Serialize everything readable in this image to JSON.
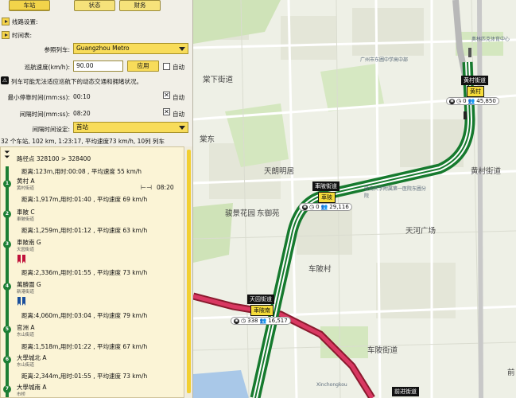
{
  "tabs": [
    "车站",
    "状态",
    "财务"
  ],
  "rows": {
    "line_settings": "线路设置:",
    "timetable": "时间表:",
    "ref_train_label": "参照列车:",
    "ref_train_value": "Guangzhou Metro",
    "cruise_label": "巡航速度(km/h):",
    "cruise_value": "90.00",
    "apply": "应用",
    "auto": "自动",
    "warning": "列车可能无法适应巡航下的动态交通和拥堵状况。",
    "min_stop_label": "最小停靠时间(mm:ss):",
    "min_stop_value": "00:10",
    "interval_label": "间隔时间(mm:ss):",
    "interval_value": "08:20",
    "interval_setting_label": "间隔时间设定:",
    "interval_setting_value": "首站",
    "summary": "32 个车站, 102 km, 1:23:17, 平均速度73 km/h, 10列 列车"
  },
  "timetable": {
    "route": "路径点 328100 > 328400",
    "stations": [
      {
        "num": "1",
        "name": "黄村 A",
        "sub": "黄村街道",
        "time": "08:20"
      },
      {
        "num": "2",
        "name": "車陂 C",
        "sub": "車陂街道"
      },
      {
        "num": "3",
        "name": "車陂南 G",
        "sub": "天园街道"
      },
      {
        "num": "4",
        "name": "萬勝圍 G",
        "sub": "新港街道"
      },
      {
        "num": "5",
        "name": "官洲 A",
        "sub": "东山街道"
      },
      {
        "num": "6",
        "name": "大學城北 A",
        "sub": "东山街道"
      },
      {
        "num": "7",
        "name": "大學城南 A",
        "sub": "市桥"
      }
    ],
    "segments": [
      "距离:123m,用时:00:08 , 平均速度 55 km/h",
      "距离:1,917m,用时:01:40 , 平均速度 69 km/h",
      "距离:1,259m,用时:01:12 , 平均速度 63 km/h",
      "距离:2,336m,用时:01:55 , 平均速度 73 km/h",
      "距离:4,060m,用时:03:04 , 平均速度 79 km/h",
      "距离:1,518m,用时:01:22 , 平均速度 67 km/h",
      "距离:2,344m,用时:01:55 , 平均速度 73 km/h"
    ]
  },
  "map": {
    "labels": {
      "tangxia": "棠下街道",
      "tangdong": "棠东",
      "tianlang": "天朗明居",
      "junjing": "骏景花园",
      "dongyuan": "东御苑",
      "huangcun_st": "黄村街道",
      "tianhe": "天河广场",
      "chebeicun": "车陂村",
      "chebei_st": "车陂街道",
      "qian": "前",
      "xinchong": "Xinchongkou",
      "olympic": "奥林匹克体育中心",
      "gz_east": "广州市东圃中学高中部",
      "hospital": "暨南大学附属第一医院东圃分院"
    },
    "stations": [
      {
        "name": "黄村街道",
        "badge": "黄村",
        "passengers": "45,850",
        "waiting": "0"
      },
      {
        "name": "車陂街道",
        "badge": "車陂",
        "passengers": "29,116",
        "waiting": "0"
      },
      {
        "name": "天园街道",
        "badge": "車陂南",
        "passengers": "16,517",
        "waiting": "338"
      }
    ],
    "next": "前进街道"
  }
}
